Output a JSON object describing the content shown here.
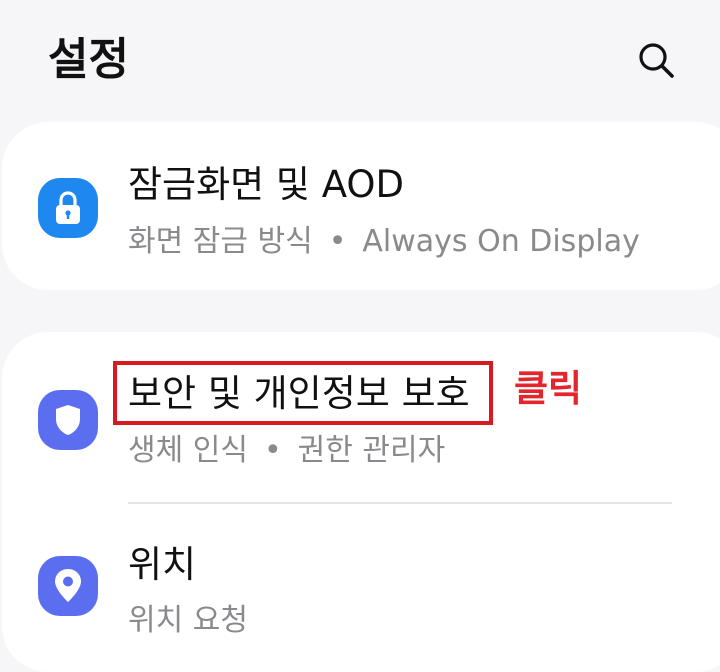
{
  "header": {
    "title": "설정"
  },
  "items": [
    {
      "title": "잠금화면 및 AOD",
      "subtitle_parts": [
        "화면 잠금 방식",
        "Always On Display"
      ],
      "icon": "lock-icon",
      "icon_color": "#1e88f0"
    },
    {
      "title": "보안 및 개인정보 보호",
      "subtitle_parts": [
        "생체 인식",
        "권한 관리자"
      ],
      "icon": "shield-icon",
      "icon_color": "#5b6ef0"
    },
    {
      "title": "위치",
      "subtitle_parts": [
        "위치 요청"
      ],
      "icon": "location-pin-icon",
      "icon_color": "#5b6ef0"
    }
  ],
  "separator": "•",
  "annotation": {
    "label": "클릭",
    "color": "#e3262d"
  }
}
